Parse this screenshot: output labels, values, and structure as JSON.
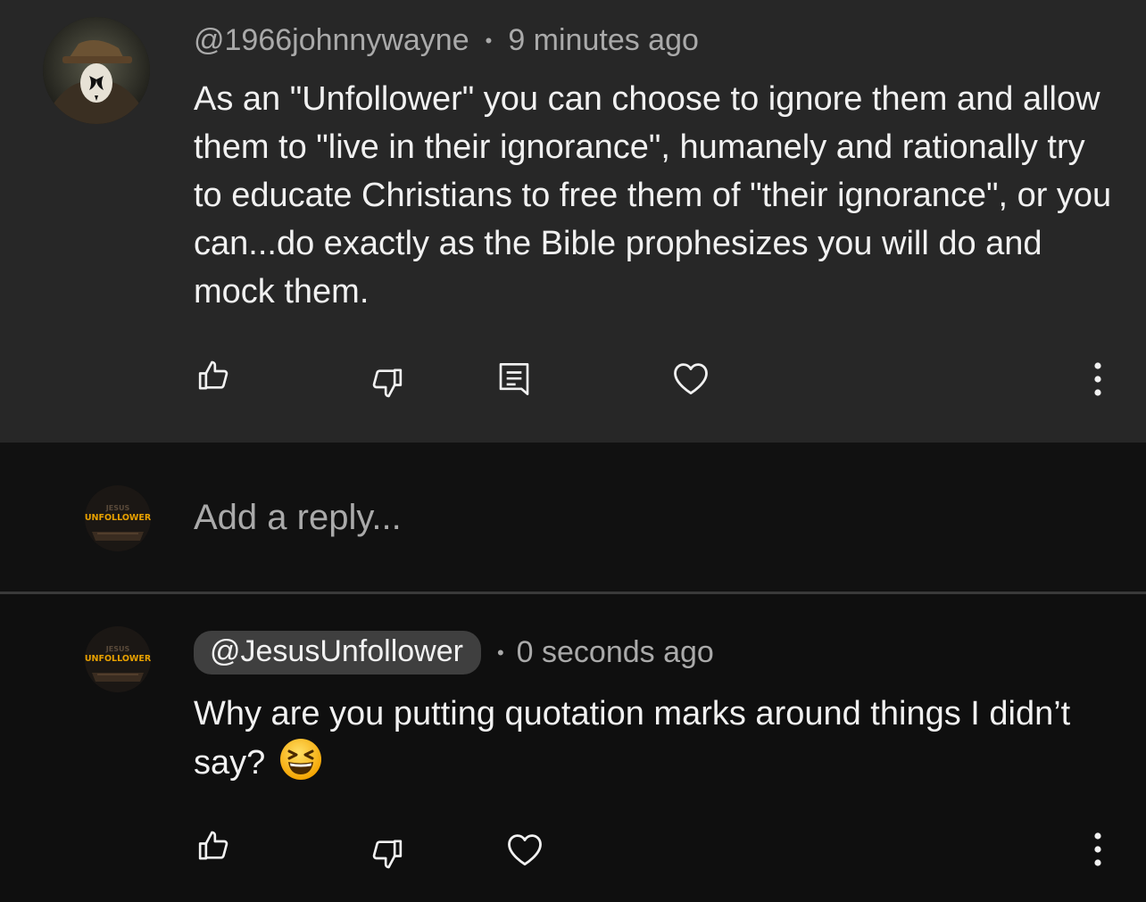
{
  "comment": {
    "author": "@1966johnnywayne",
    "separator": "•",
    "time": "9 minutes ago",
    "text": "As an \"Unfollower\" you can choose to ignore them and allow them to \"live in their ignorance\", humanely and rationally try to educate Christians to free them of \"their ignorance\", or you can...do exactly as the Bible prophesizes you will do and mock them.",
    "icons": [
      "thumbs-up-icon",
      "thumbs-down-icon",
      "reply-icon",
      "heart-icon",
      "more-vert-icon"
    ]
  },
  "reply_box": {
    "placeholder": "Add a reply...",
    "avatar_text_top": "JESUS",
    "avatar_text_main": "UNFOLLOWER"
  },
  "reply": {
    "author": "@JesusUnfollower",
    "separator": "•",
    "time": "0 seconds ago",
    "text": "Why are you putting quotation marks around things I didn’t say?",
    "emoji": "grinning-squinting-face",
    "avatar_text_top": "JESUS",
    "avatar_text_main": "UNFOLLOWER",
    "icons": [
      "thumbs-up-icon",
      "thumbs-down-icon",
      "heart-icon",
      "more-vert-icon"
    ]
  },
  "colors": {
    "top_background": "#272727",
    "page_background": "#0f0f0f",
    "text_primary": "#f1f1f1",
    "text_secondary": "#aaaaaa",
    "chip_background": "#3f3f3f",
    "avatar_accent": "#e8a100"
  }
}
